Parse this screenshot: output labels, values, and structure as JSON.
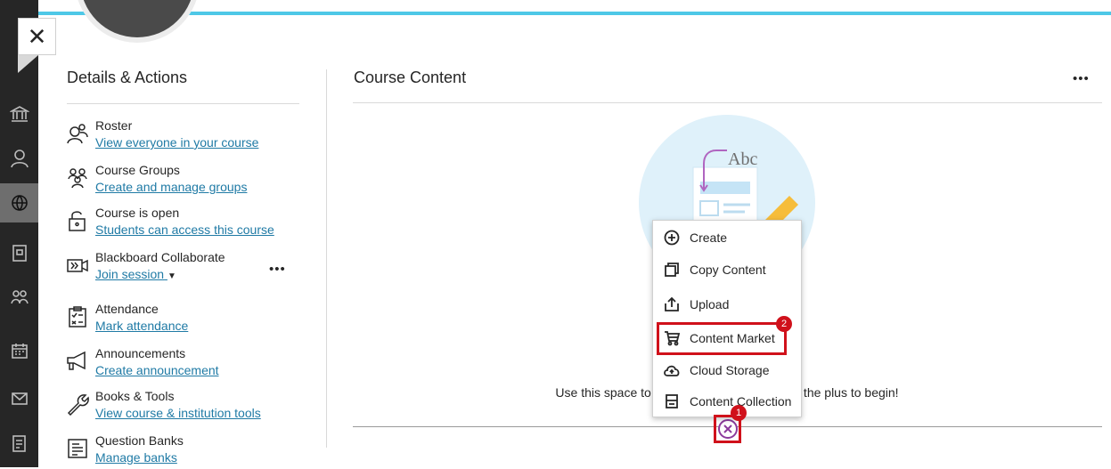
{
  "details": {
    "title": "Details & Actions",
    "actions": [
      {
        "title": "Roster",
        "link": "View everyone in your course",
        "icon": "roster-icon"
      },
      {
        "title": "Course Groups",
        "link": "Create and manage groups",
        "icon": "groups-icon"
      },
      {
        "title": "Course is open",
        "link": "Students can access this course",
        "icon": "unlock-icon"
      },
      {
        "title": "Blackboard Collaborate",
        "link": "Join session",
        "icon": "video-icon"
      },
      {
        "title": "Attendance",
        "link": "Mark attendance",
        "icon": "attendance-icon"
      },
      {
        "title": "Announcements",
        "link": "Create announcement",
        "icon": "megaphone-icon"
      },
      {
        "title": "Books & Tools",
        "link": "View course & institution tools",
        "icon": "wrench-icon"
      },
      {
        "title": "Question Banks",
        "link": "Manage banks",
        "icon": "question-bank-icon"
      }
    ],
    "more_label": "•••"
  },
  "content": {
    "title": "Course Content",
    "more_label": "•••",
    "empty_text": "Use this space to                                            the plus to begin!",
    "illustration_text": "Abc"
  },
  "menu": {
    "items": [
      {
        "label": "Create",
        "icon": "plus-circle-icon"
      },
      {
        "label": "Copy Content",
        "icon": "copy-icon"
      },
      {
        "label": "Upload",
        "icon": "upload-icon"
      },
      {
        "label": "Content Market",
        "icon": "cart-icon"
      },
      {
        "label": "Cloud Storage",
        "icon": "cloud-icon"
      },
      {
        "label": "Content Collection",
        "icon": "collection-icon"
      }
    ]
  },
  "annotations": {
    "badge_1": "1",
    "badge_2": "2"
  },
  "close_label": "✕",
  "colors": {
    "accent": "#4ec8e7",
    "link": "#1f7aa5",
    "highlight": "#d0111b",
    "plus": "#8b3b9c",
    "rail": "#262626"
  }
}
